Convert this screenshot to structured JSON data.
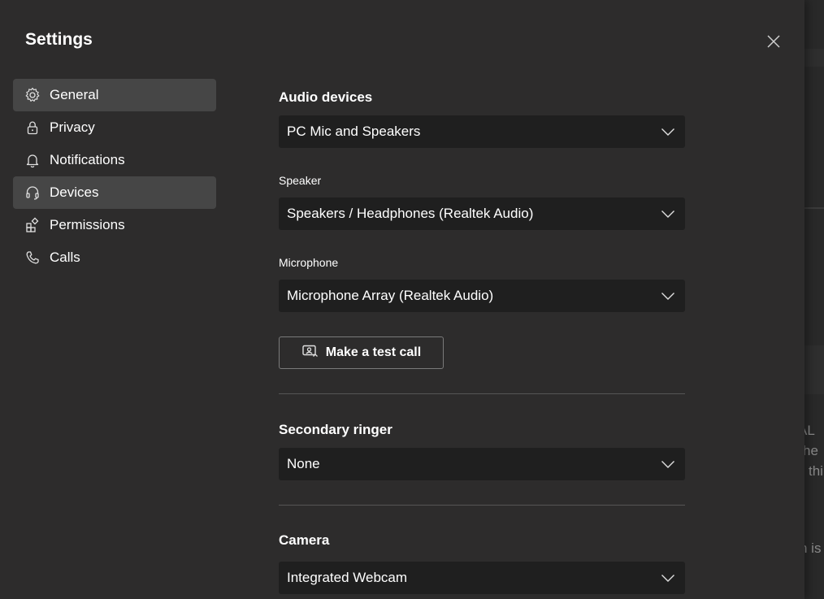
{
  "dialog": {
    "title": "Settings"
  },
  "nav": {
    "items": [
      {
        "label": "General",
        "icon": "gear-icon",
        "active": true
      },
      {
        "label": "Privacy",
        "icon": "lock-icon",
        "active": false
      },
      {
        "label": "Notifications",
        "icon": "bell-icon",
        "active": false
      },
      {
        "label": "Devices",
        "icon": "headset-icon",
        "active": true
      },
      {
        "label": "Permissions",
        "icon": "apps-icon",
        "active": false
      },
      {
        "label": "Calls",
        "icon": "phone-icon",
        "active": false
      }
    ]
  },
  "devices": {
    "audio_devices": {
      "label": "Audio devices",
      "value": "PC Mic and Speakers"
    },
    "speaker": {
      "label": "Speaker",
      "value": "Speakers / Headphones (Realtek Audio)"
    },
    "microphone": {
      "label": "Microphone",
      "value": "Microphone Array (Realtek Audio)"
    },
    "test_call": {
      "label": "Make a test call"
    },
    "secondary_ringer": {
      "label": "Secondary ringer",
      "value": "None"
    },
    "camera": {
      "label": "Camera",
      "value": "Integrated Webcam"
    }
  },
  "background_app": {
    "fragments": [
      "AL",
      "he",
      "thi",
      "n is"
    ]
  },
  "colors": {
    "dialog_bg": "#2d2c2c",
    "select_bg": "#1f1f1f",
    "active_nav_bg": "#464646",
    "text": "#ffffff"
  }
}
